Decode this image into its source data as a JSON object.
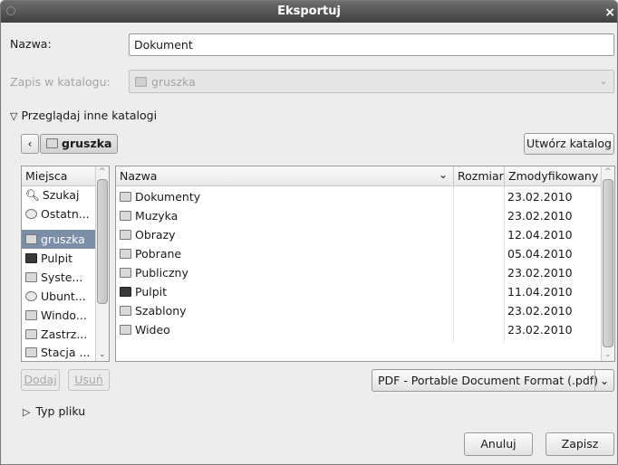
{
  "window": {
    "title": "Eksportuj",
    "close_glyph": "×"
  },
  "name_field": {
    "label": "Nazwa:",
    "value": "Dokument"
  },
  "save_in": {
    "label": "Zapis w katalogu:",
    "value": "gruszka"
  },
  "browse_toggle": {
    "label": "Przeglądaj inne katalogi"
  },
  "path_bar": {
    "current": "gruszka",
    "create_folder": "Utwórz katalog"
  },
  "places": {
    "header": "Miejsca",
    "items": [
      {
        "label": "Szukaj",
        "icon": "search-icon"
      },
      {
        "label": "Ostatn...",
        "icon": "recent-icon"
      },
      {
        "label": "gruszka",
        "icon": "home-folder-icon",
        "selected": true
      },
      {
        "label": "Pulpit",
        "icon": "desktop-icon"
      },
      {
        "label": "Syste...",
        "icon": "drive-icon"
      },
      {
        "label": "Ubunt...",
        "icon": "cdrom-icon"
      },
      {
        "label": "Windo...",
        "icon": "drive-icon"
      },
      {
        "label": "Zastrz...",
        "icon": "drive-icon"
      },
      {
        "label": "Stacja ...",
        "icon": "floppy-icon"
      }
    ],
    "add_label": "Dodaj",
    "remove_label": "Usuń"
  },
  "files": {
    "columns": {
      "name": "Nazwa",
      "size": "Rozmiar",
      "modified": "Zmodyfikowany"
    },
    "rows": [
      {
        "name": "Dokumenty",
        "size": "",
        "modified": "23.02.2010",
        "icon": "documents-folder-icon"
      },
      {
        "name": "Muzyka",
        "size": "",
        "modified": "23.02.2010",
        "icon": "music-folder-icon"
      },
      {
        "name": "Obrazy",
        "size": "",
        "modified": "12.04.2010",
        "icon": "pictures-folder-icon"
      },
      {
        "name": "Pobrane",
        "size": "",
        "modified": "05.04.2010",
        "icon": "downloads-folder-icon"
      },
      {
        "name": "Publiczny",
        "size": "",
        "modified": "23.02.2010",
        "icon": "public-folder-icon"
      },
      {
        "name": "Pulpit",
        "size": "",
        "modified": "11.04.2010",
        "icon": "desktop-folder-icon"
      },
      {
        "name": "Szablony",
        "size": "",
        "modified": "23.02.2010",
        "icon": "templates-folder-icon"
      },
      {
        "name": "Wideo",
        "size": "",
        "modified": "23.02.2010",
        "icon": "videos-folder-icon"
      }
    ]
  },
  "file_type": {
    "selected": "PDF - Portable Document Format (.pdf)",
    "expander_label": "Typ pliku"
  },
  "actions": {
    "cancel": "Anuluj",
    "save": "Zapisz"
  }
}
